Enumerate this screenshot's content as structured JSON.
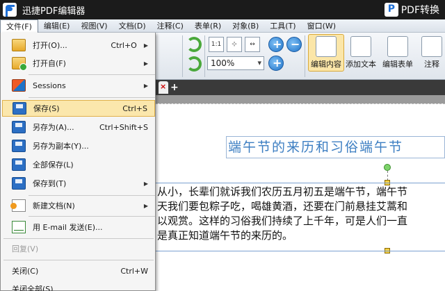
{
  "app": {
    "title": "迅捷PDF编辑器",
    "convert_label": "PDF转换"
  },
  "menubar": {
    "items": [
      "文件(F)",
      "编辑(E)",
      "视图(V)",
      "文档(D)",
      "注释(C)",
      "表单(R)",
      "对象(B)",
      "工具(T)",
      "窗口(W)"
    ]
  },
  "ribbon": {
    "zoom_value": "100%",
    "edit_content_label": "编辑内容",
    "add_text_label": "添加文本",
    "edit_form_label": "编辑表单",
    "annotate_label": "注释"
  },
  "file_menu": {
    "open": {
      "label": "打开(O)...",
      "shortcut": "Ctrl+O"
    },
    "open_from": {
      "label": "打开自(F)"
    },
    "sessions": {
      "label": "Sessions"
    },
    "save": {
      "label": "保存(S)",
      "shortcut": "Ctrl+S"
    },
    "save_as": {
      "label": "另存为(A)...",
      "shortcut": "Ctrl+Shift+S"
    },
    "save_copy": {
      "label": "另存为副本(Y)..."
    },
    "save_all": {
      "label": "全部保存(L)"
    },
    "save_to": {
      "label": "保存到(T)"
    },
    "new_doc": {
      "label": "新建文档(N)"
    },
    "email": {
      "label": "用 E-mail 发送(E)..."
    },
    "revert": {
      "label": "回复(V)"
    },
    "close": {
      "label": "关闭(C)",
      "shortcut": "Ctrl+W"
    },
    "close_all": {
      "label": "关闭全部(S)"
    }
  },
  "document": {
    "heading": "端午节的来历和习俗端午节",
    "paragraph": [
      "从小，长辈们就诉我们农历五月初五是端午节，端午节",
      "天我们要包粽子吃，喝雄黄酒，还要在门前悬挂艾蒿和",
      "以观赏。这样的习俗我们持续了上千年，可是人们一直",
      "是真正知道端午节的来历的。"
    ]
  }
}
